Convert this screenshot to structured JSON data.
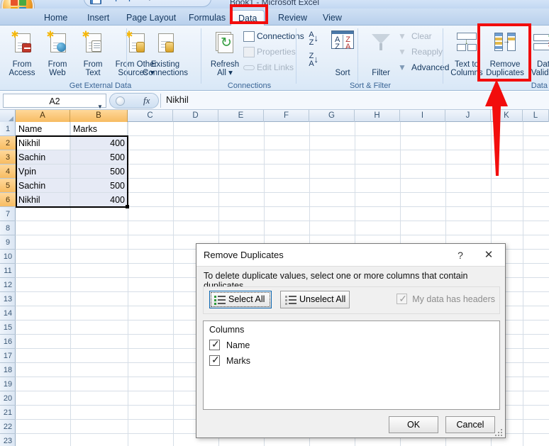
{
  "titlebar": {
    "title": "Book1  -  Microsoft Excel"
  },
  "quick_access": {
    "save_icon": "save-icon",
    "undo_icon": "undo-icon",
    "redo_icon": "redo-icon",
    "customize_icon": "chevron-down-icon"
  },
  "office_button": {
    "name": "office-orb"
  },
  "ribbon": {
    "tabs": [
      {
        "label": "Home",
        "active": false
      },
      {
        "label": "Insert",
        "active": false
      },
      {
        "label": "Page Layout",
        "active": false
      },
      {
        "label": "Formulas",
        "active": false
      },
      {
        "label": "Data",
        "active": true
      },
      {
        "label": "Review",
        "active": false
      },
      {
        "label": "View",
        "active": false
      }
    ],
    "groups": [
      {
        "name": "Get External Data",
        "label": "Get External Data",
        "buttons": [
          {
            "line1": "From",
            "line2": "Access",
            "icon": "from-access-icon"
          },
          {
            "line1": "From",
            "line2": "Web",
            "icon": "from-web-icon"
          },
          {
            "line1": "From",
            "line2": "Text",
            "icon": "from-text-icon"
          },
          {
            "line1": "From Other",
            "line2": "Sources ▾",
            "icon": "from-other-sources-icon"
          },
          {
            "line1": "Existing",
            "line2": "Connections",
            "icon": "existing-connections-icon"
          }
        ]
      },
      {
        "name": "Connections",
        "label": "Connections",
        "big": {
          "line1": "Refresh",
          "line2": "All ▾",
          "icon": "refresh-all-icon"
        },
        "commands": [
          {
            "label": "Connections",
            "icon": "connections-icon",
            "disabled": false
          },
          {
            "label": "Properties",
            "icon": "properties-icon",
            "disabled": true
          },
          {
            "label": "Edit Links",
            "icon": "edit-links-icon",
            "disabled": true
          }
        ]
      },
      {
        "name": "Sort & Filter",
        "label": "Sort & Filter",
        "sort_az_icon": "sort-ascending-icon",
        "sort_za_icon": "sort-descending-icon",
        "sort_label": "Sort",
        "filter_label": "Filter",
        "filter_icon": "filter-funnel-icon",
        "commands": [
          {
            "label": "Clear",
            "icon": "clear-filter-icon",
            "disabled": true
          },
          {
            "label": "Reapply",
            "icon": "reapply-filter-icon",
            "disabled": true
          },
          {
            "label": "Advanced",
            "icon": "advanced-filter-icon",
            "disabled": false
          }
        ]
      },
      {
        "name": "Data Tools",
        "label": "Data",
        "buttons": [
          {
            "line1": "Text to",
            "line2": "Columns",
            "icon": "text-to-columns-icon"
          },
          {
            "line1": "Remove",
            "line2": "Duplicates",
            "icon": "remove-duplicates-icon"
          },
          {
            "line1": "Dat",
            "line2": "Validat",
            "icon": "data-validation-icon"
          }
        ]
      }
    ]
  },
  "formula_bar": {
    "name_box_value": "A2",
    "fx_label": "fx",
    "value": "Nikhil"
  },
  "sheet": {
    "columns": [
      "A",
      "B",
      "C",
      "D",
      "E",
      "F",
      "G",
      "H",
      "I",
      "J",
      "K",
      "L"
    ],
    "selected_columns": [
      "A",
      "B"
    ],
    "rows": [
      1,
      2,
      3,
      4,
      5,
      6,
      7,
      8,
      9,
      10,
      11,
      12,
      13,
      14,
      15,
      16,
      17,
      18,
      19,
      20,
      21,
      22,
      23
    ],
    "selected_rows": [
      2,
      3,
      4,
      5,
      6
    ],
    "active_cell": "A2",
    "selection_range": "A2:B6",
    "cells": [
      {
        "row": 1,
        "a": "Name",
        "b": "Marks"
      },
      {
        "row": 2,
        "a": "Nikhil",
        "b": "400"
      },
      {
        "row": 3,
        "a": "Sachin",
        "b": "500"
      },
      {
        "row": 4,
        "a": "Vpin",
        "b": "500"
      },
      {
        "row": 5,
        "a": "Sachin",
        "b": "500"
      },
      {
        "row": 6,
        "a": "Nikhil",
        "b": "400"
      }
    ]
  },
  "annotations": {
    "color": "#f20d0d",
    "data_tab_highlight": "data-tab-highlight-box",
    "remove_duplicates_highlight": "remove-duplicates-highlight-box",
    "arrow": "pointer-arrow-to-remove-duplicates"
  },
  "dialog": {
    "title": "Remove Duplicates",
    "help_icon": "?",
    "close_icon": "✕",
    "description": "To delete duplicate values, select one or more columns that contain duplicates.",
    "select_all_label": "Select All",
    "unselect_all_label": "Unselect All",
    "headers_checkbox_label": "My data has headers",
    "headers_checked": true,
    "columns_caption": "Columns",
    "columns": [
      {
        "label": "Name",
        "checked": true
      },
      {
        "label": "Marks",
        "checked": true
      }
    ],
    "ok_label": "OK",
    "cancel_label": "Cancel"
  }
}
